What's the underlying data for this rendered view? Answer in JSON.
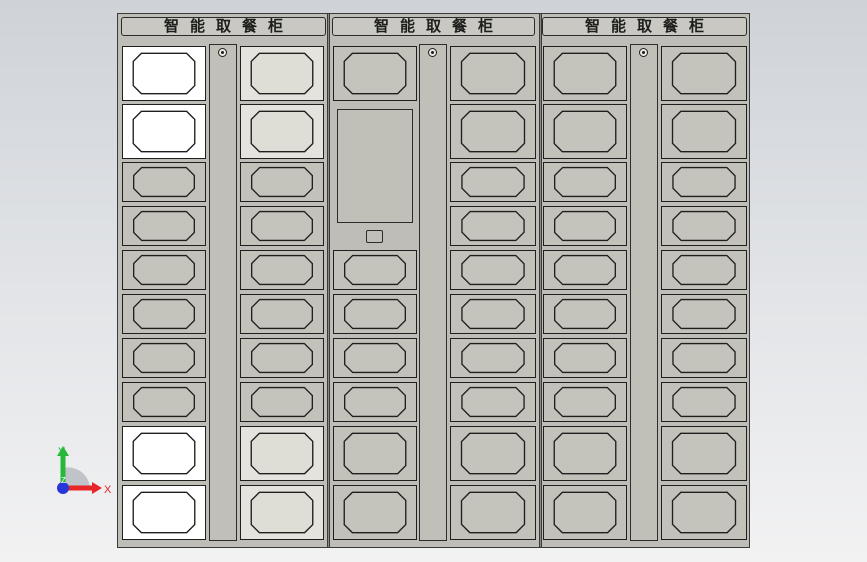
{
  "cabinet": {
    "panels": [
      {
        "title": "智能取餐柜"
      },
      {
        "title": "智能取餐柜"
      },
      {
        "title": "智能取餐柜"
      }
    ]
  },
  "axis_triad": {
    "x_label": "X",
    "y_label": "Y",
    "z_label": "Z",
    "colors": {
      "x": "#e8262a",
      "y": "#27b83a",
      "z": "#2636d8"
    }
  },
  "materials": {
    "body": "#bebdb7",
    "door": "#c2c1ba",
    "highlight_door": "#ffffff",
    "pale_door": "#e4e3de",
    "outline": "#1f1f1d"
  }
}
